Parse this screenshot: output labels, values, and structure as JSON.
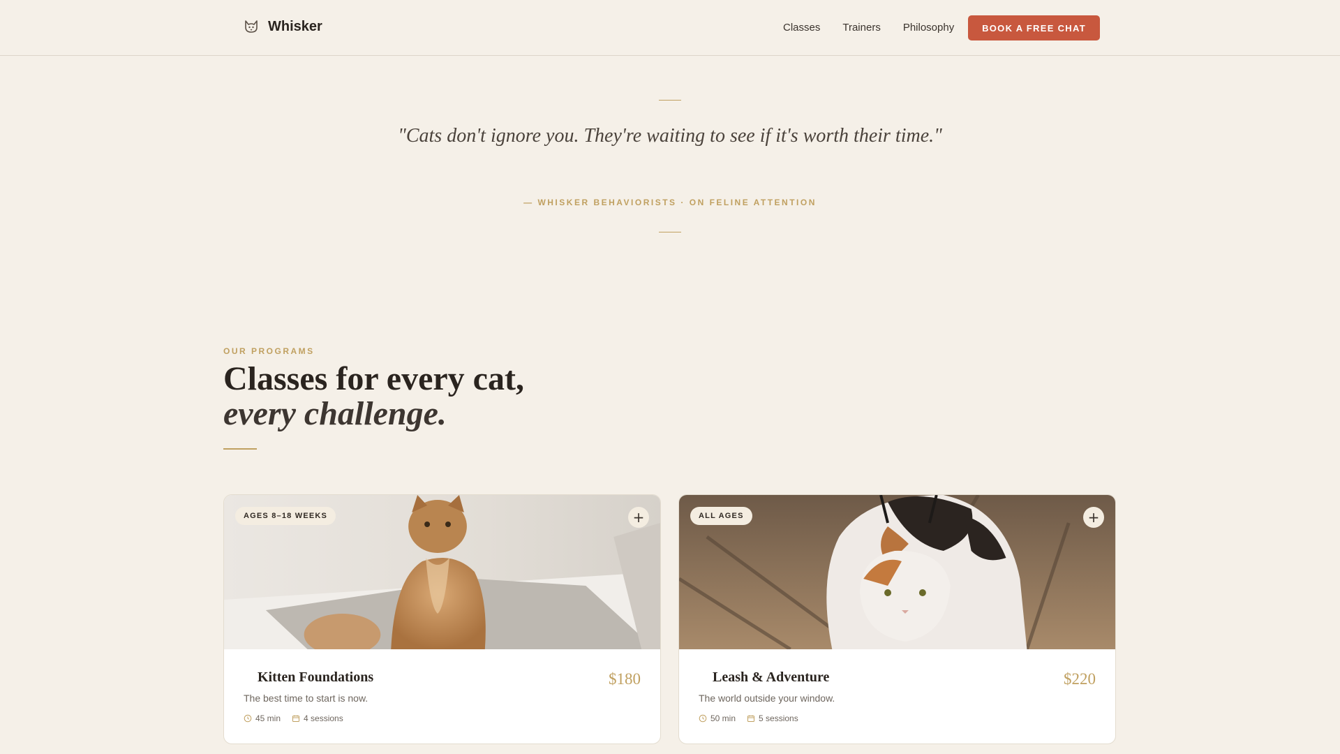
{
  "nav": {
    "brand": "Whisker",
    "brand_icon": "cat-face-icon",
    "links": [
      "Classes",
      "Trainers",
      "Philosophy"
    ],
    "cta": "BOOK A FREE CHAT"
  },
  "quote": {
    "text": "\"Cats don't ignore you. They're waiting to see if it's worth their time.\"",
    "attribution": "— WHISKER BEHAVIORISTS · ON FELINE ATTENTION"
  },
  "programs": {
    "eyebrow": "OUR PROGRAMS",
    "heading_line1": "Classes for every cat,",
    "heading_line2": "every challenge.",
    "cards": [
      {
        "badge": "AGES 8–18 WEEKS",
        "title": "Kitten Foundations",
        "price": "$180",
        "description": "The best time to start is now.",
        "duration": "45 min",
        "sessions": "4 sessions",
        "image": "orange-longhair-cat-photo"
      },
      {
        "badge": "ALL AGES",
        "title": "Leash & Adventure",
        "price": "$220",
        "description": "The world outside your window.",
        "duration": "50 min",
        "sessions": "5 sessions",
        "image": "calico-cat-harness-photo"
      }
    ]
  },
  "colors": {
    "background": "#f5f0e8",
    "accent_gold": "#c0a060",
    "cta_red": "#c8583e",
    "text_dark": "#2a241f"
  }
}
